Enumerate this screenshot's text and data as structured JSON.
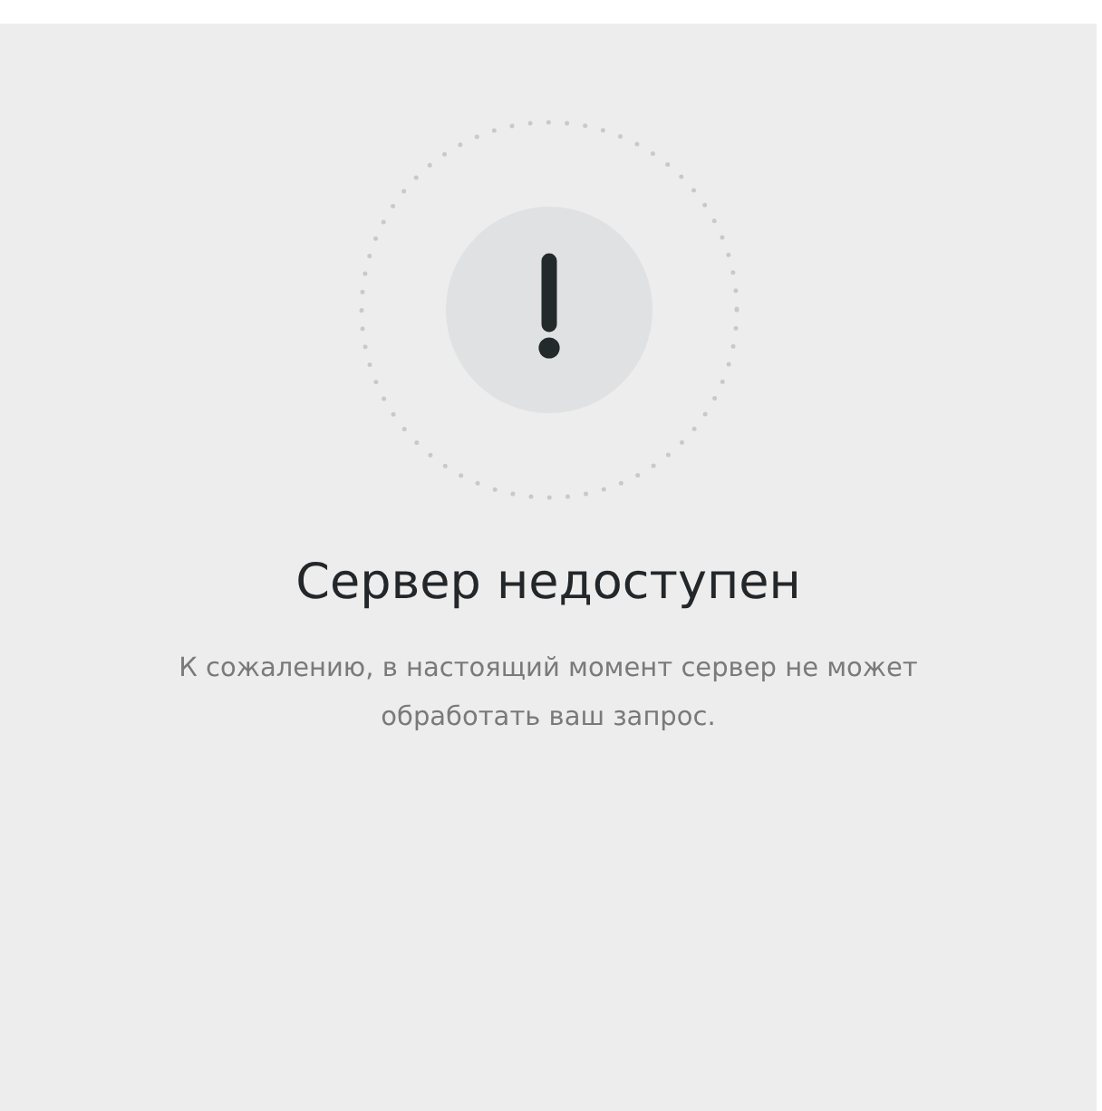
{
  "error": {
    "title": "Сервер недоступен",
    "message": "К сожалению, в настоящий момент сервер не может обработать ваш запрос."
  }
}
